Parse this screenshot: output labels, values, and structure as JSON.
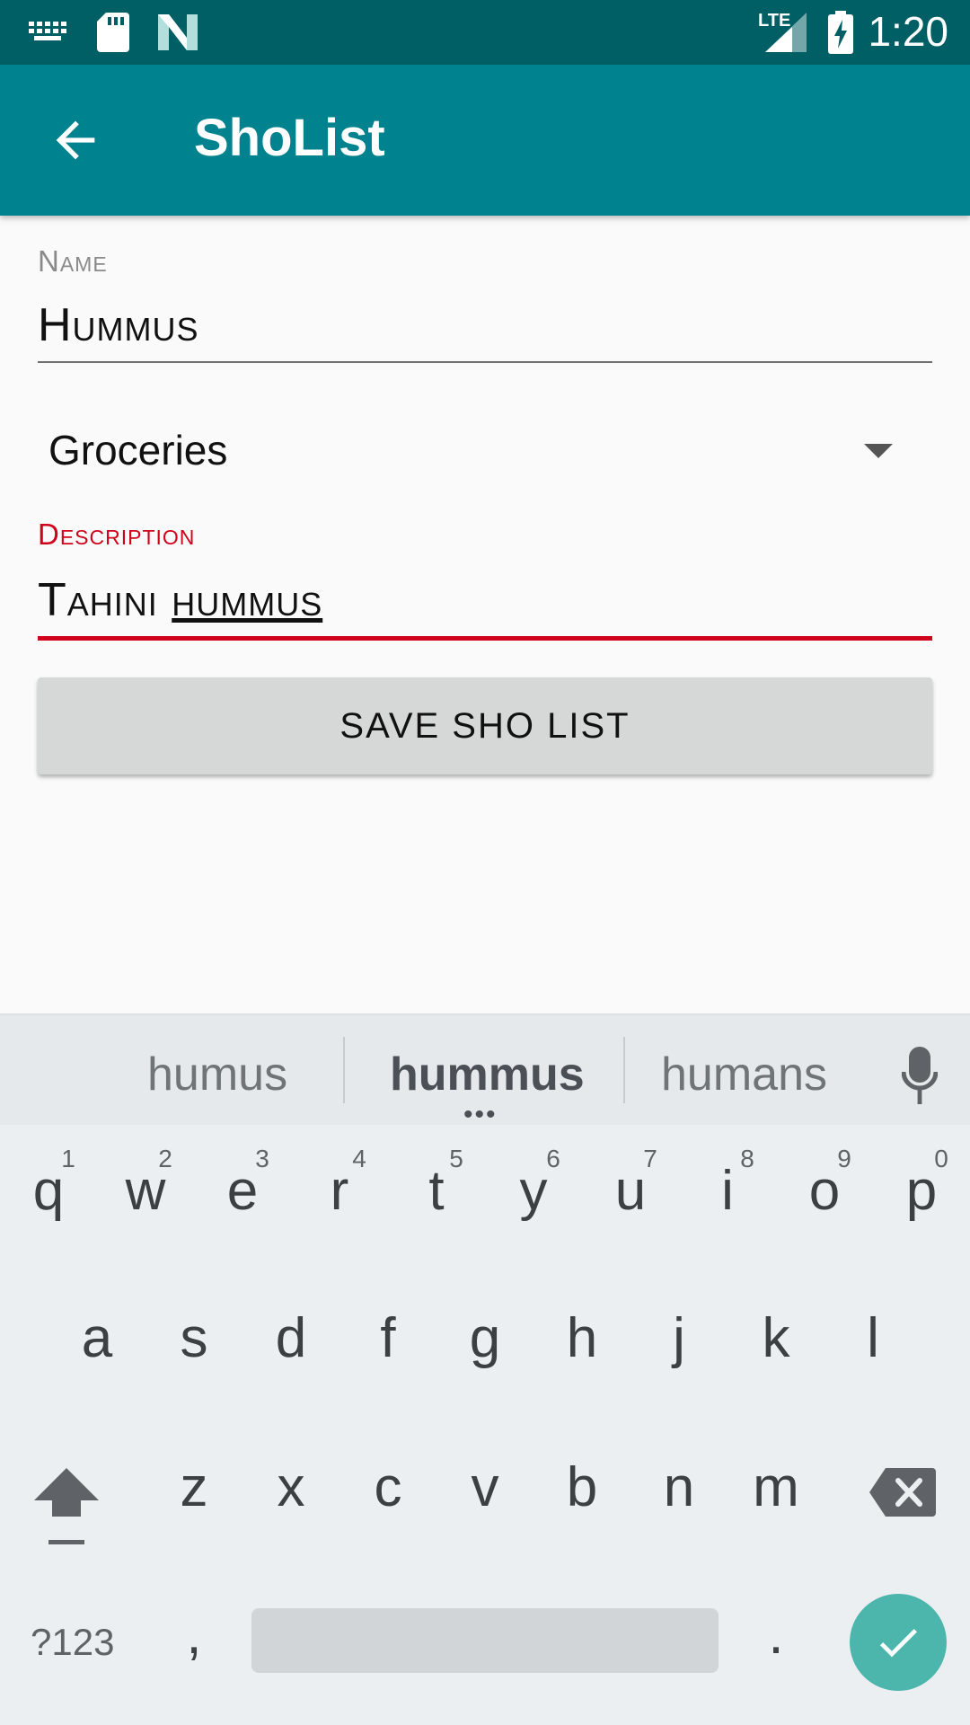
{
  "status_bar": {
    "time": "1:20",
    "icons": [
      "keyboard-icon",
      "sd-card-icon",
      "n-logo-icon",
      "lte-signal-icon",
      "battery-charging-icon"
    ],
    "network": "LTE"
  },
  "app_bar": {
    "title": "ShoList",
    "nav_icon": "arrow-back-icon"
  },
  "form": {
    "name_label": "Name",
    "name_value": "Hummus",
    "category_value": "Groceries",
    "description_label": "Description",
    "description_value_plain": "Tahini ",
    "description_value_composing": "hummus",
    "save_button": "SAVE SHO LIST"
  },
  "colors": {
    "status_bar": "#005f64",
    "app_bar": "#00838f",
    "error_accent": "#d0021b",
    "enter_key": "#4db6ac"
  },
  "keyboard": {
    "suggestions": [
      "humus",
      "hummus",
      "humans"
    ],
    "row1": [
      "q",
      "w",
      "e",
      "r",
      "t",
      "y",
      "u",
      "i",
      "o",
      "p"
    ],
    "row1_hints": [
      "1",
      "2",
      "3",
      "4",
      "5",
      "6",
      "7",
      "8",
      "9",
      "0"
    ],
    "row2": [
      "a",
      "s",
      "d",
      "f",
      "g",
      "h",
      "j",
      "k",
      "l"
    ],
    "row3": [
      "z",
      "x",
      "c",
      "v",
      "b",
      "n",
      "m"
    ],
    "symbols_key": "?123",
    "comma_key": ",",
    "period_key": "."
  }
}
